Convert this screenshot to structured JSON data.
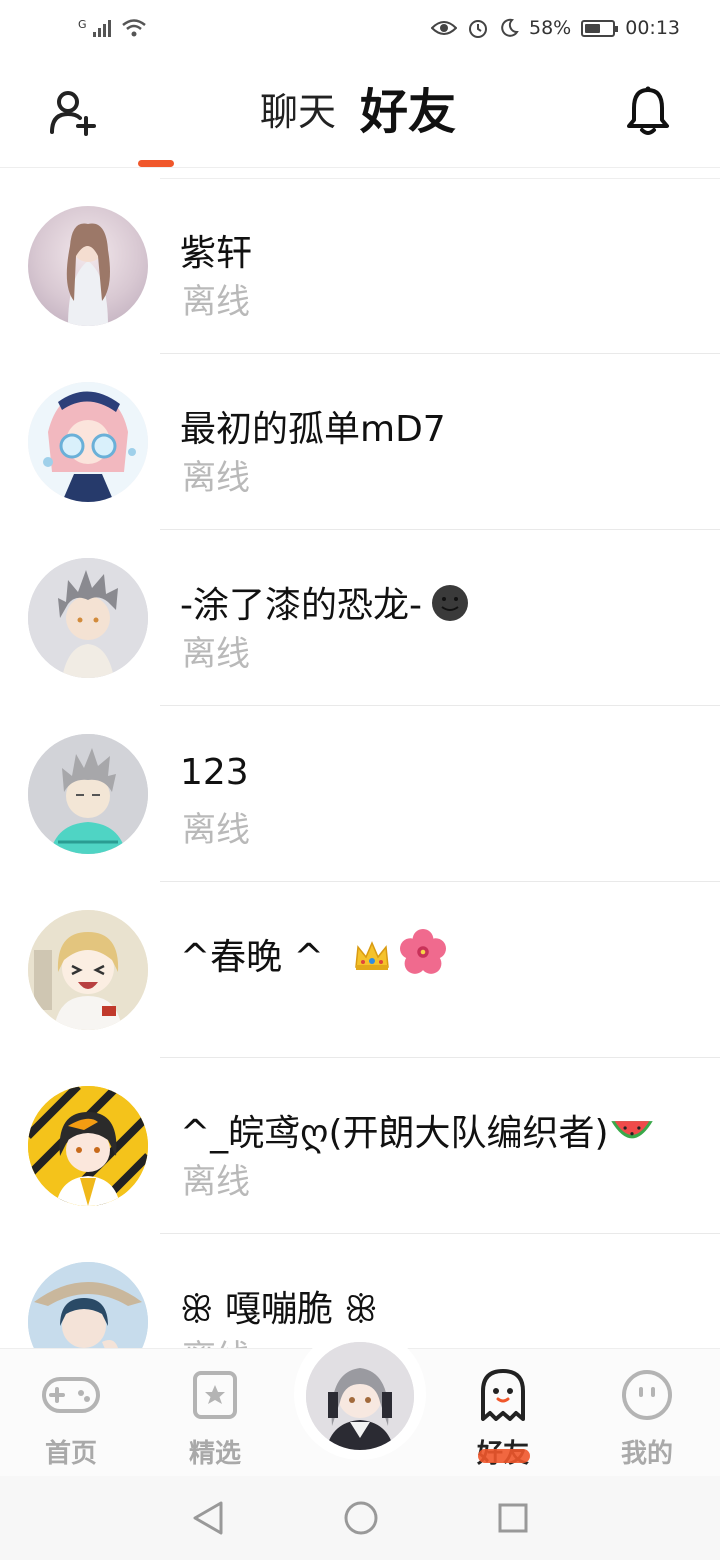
{
  "status_bar": {
    "network": "G",
    "battery": "58%",
    "time": "00:13"
  },
  "header": {
    "tab_chat": "聊天",
    "tab_friends": "好友"
  },
  "friends": [
    {
      "name": "紫轩",
      "status": "离线",
      "avatar_color": "#d9d0d6"
    },
    {
      "name": "最初的孤单mD7",
      "status": "离线",
      "avatar_color": "#e9dbe2"
    },
    {
      "name": "-涂了漆的恐龙-",
      "status": "离线",
      "avatar_color": "#cfcfd6",
      "emoji": "dark-smiley-icon"
    },
    {
      "name": "123",
      "status": "离线",
      "avatar_color": "#c8c9ce"
    },
    {
      "name": "^春晚 ^",
      "status": "",
      "avatar_color": "#efe6cf",
      "emoji": "crown-and-hibiscus-icon"
    },
    {
      "name": "^_皖鸢ღ(开朗大队编织者)",
      "status": "离线",
      "avatar_color": "#f2c21a",
      "emoji": "watermelon-icon"
    },
    {
      "name": "ꕥ 嘎嘣脆 ꕥ",
      "status": "离线",
      "avatar_color": "#bcd3e4"
    }
  ],
  "bottom_nav": {
    "home": "首页",
    "featured": "精选",
    "friends": "好友",
    "mine": "我的"
  },
  "colors": {
    "accent": "#f0572b",
    "offline": "#b9b9b9"
  }
}
